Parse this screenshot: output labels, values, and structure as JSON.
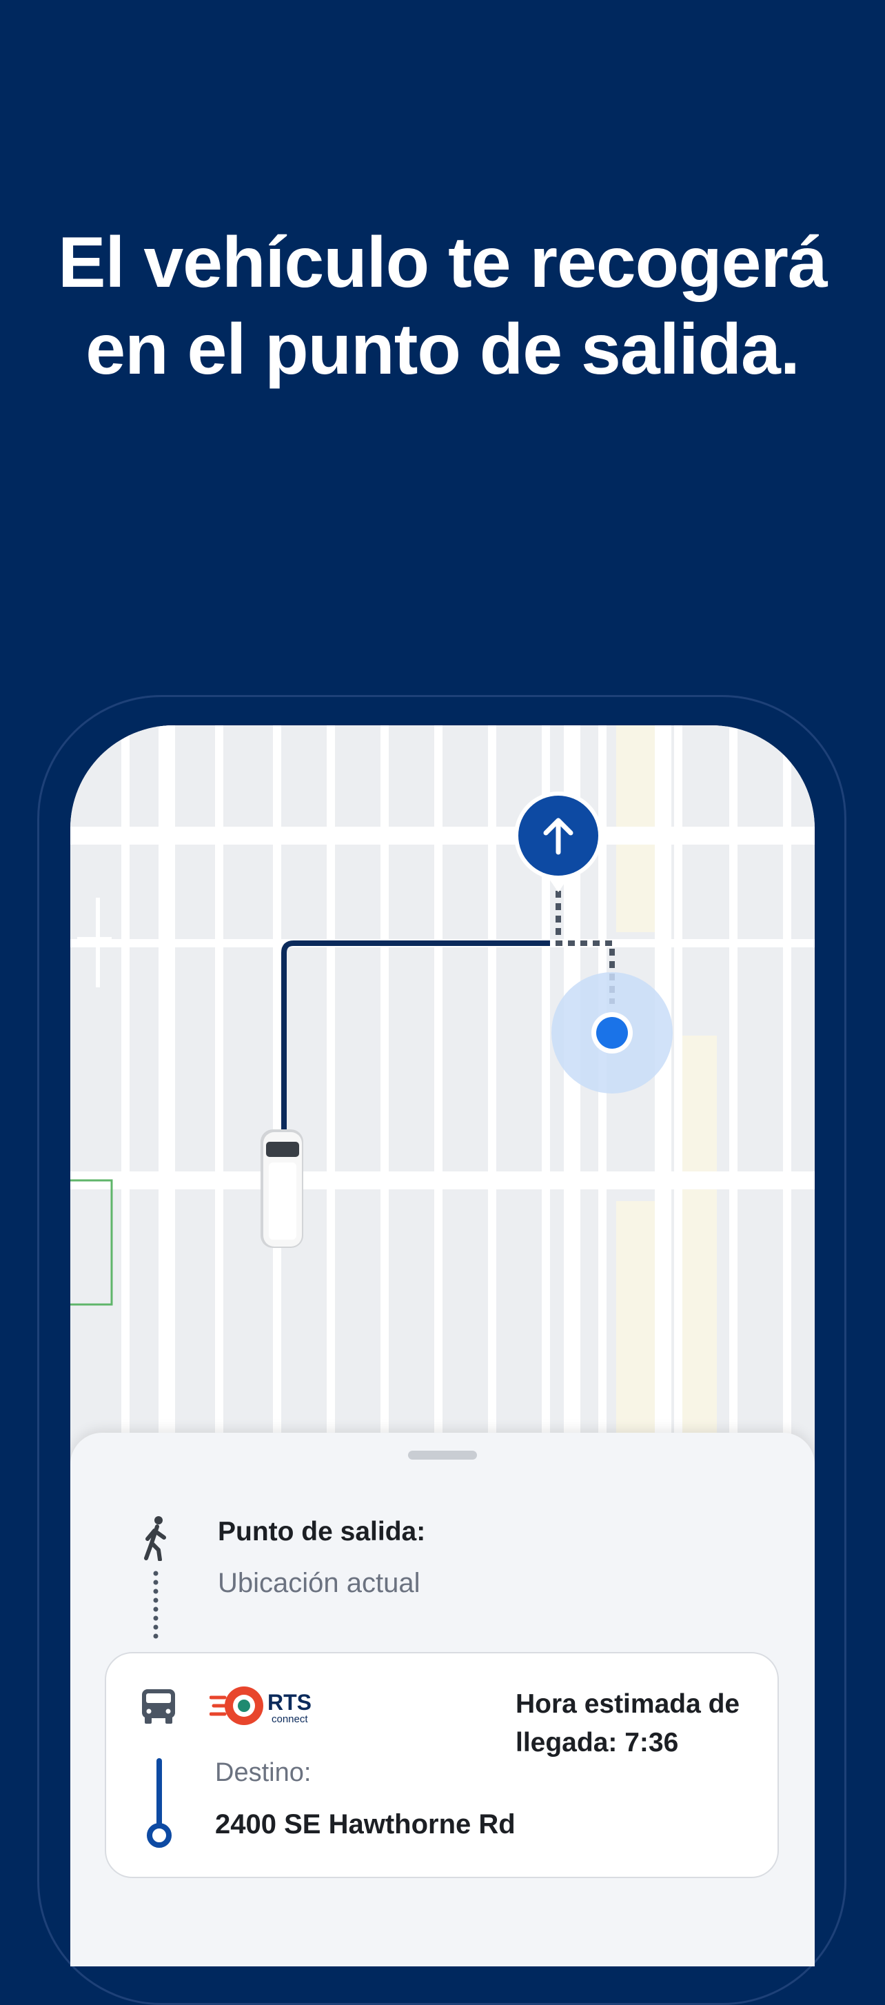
{
  "headline": "El vehículo te recogerá en el punto de salida.",
  "pickup": {
    "label": "Punto de salida:",
    "value": "Ubicación actual"
  },
  "trip": {
    "provider_logo_text": "RTS",
    "provider_logo_subtext": "connect",
    "eta": "Hora estimada de llegada: 7:36",
    "destination_label": "Destino:",
    "destination_value": "2400 SE Hawthorne Rd"
  },
  "icons": {
    "walk": "walking-person-icon",
    "van": "van-icon",
    "arrow": "arrow-up-icon",
    "route": "route-line-icon"
  },
  "colors": {
    "background": "#00285e",
    "route": "#0b2a5b",
    "user_location": "#1a73e8",
    "pickup_marker": "#0d4aa3",
    "accent_logo": "#e8452c"
  }
}
